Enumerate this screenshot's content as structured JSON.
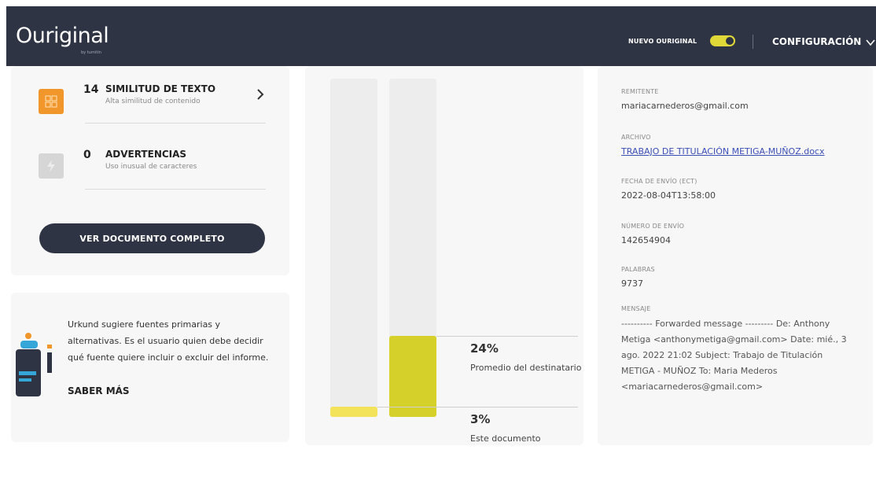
{
  "app": {
    "logo": "Ouriginal",
    "logo_sub": "by turnitin",
    "nuevo_label": "NUEVO OURIGINAL",
    "nuevo_on": true,
    "config_label": "CONFIGURACIÓN"
  },
  "summary": {
    "items": [
      {
        "count": "14",
        "title": "SIMILITUD DE TEXTO",
        "subtitle": "Alta similitud de contenido",
        "color": "#f0962a"
      },
      {
        "count": "0",
        "title": "ADVERTENCIAS",
        "subtitle": "Uso inusual de caracteres",
        "color": "#d6d6d6"
      }
    ],
    "button_label": "VER DOCUMENTO COMPLETO"
  },
  "tip": {
    "text": "Urkund sugiere fuentes primarias y alternativas. Es el usuario quien debe decidir qué fuente quiere incluir o excluir del informe.",
    "link_label": "SABER MÁS"
  },
  "comparison": {
    "document": {
      "value": 3,
      "label_pct": "3%",
      "label": "Este documento",
      "color": "#f2e35a"
    },
    "average": {
      "value": 24,
      "label_pct": "24%",
      "label": "Promedio del destinatario",
      "color": "#d6d12a"
    }
  },
  "metadata": {
    "remitente_label": "REMITENTE",
    "remitente": "mariacarnederos@gmail.com",
    "archivo_label": "ARCHIVO",
    "archivo": "TRABAJO DE TITULACIÓN METIGA-MUÑOZ.docx",
    "fecha_label": "FECHA DE ENVÍO (ECT)",
    "fecha": "2022-08-04T13:58:00",
    "numero_label": "NÚMERO DE ENVÍO",
    "numero": "142654904",
    "palabras_label": "PALABRAS",
    "palabras": "9737",
    "mensaje_label": "MENSAJE",
    "mensaje": "---------- Forwarded message --------- De: Anthony Metiga <anthonymetiga@gmail.com> Date: mié., 3 ago. 2022 21:02 Subject: Trabajo de Titulación METIGA - MUÑOZ To: Maria Mederos <mariacarnederos@gmail.com>"
  }
}
